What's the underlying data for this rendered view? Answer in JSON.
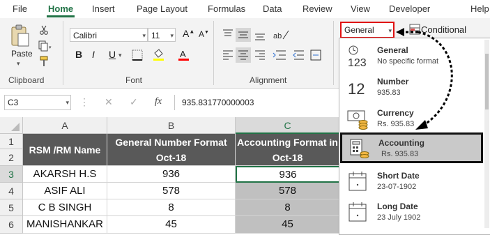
{
  "menu": {
    "tabs": [
      "File",
      "Home",
      "Insert",
      "Page Layout",
      "Formulas",
      "Data",
      "Review",
      "View",
      "Developer",
      "Help"
    ],
    "active": "Home"
  },
  "ribbon": {
    "clipboard": {
      "paste_label": "Paste",
      "group_label": "Clipboard"
    },
    "font": {
      "name": "Calibri",
      "size": "11",
      "group_label": "Font",
      "bold": "B",
      "italic": "I",
      "underline": "U"
    },
    "alignment": {
      "group_label": "Alignment"
    },
    "number": {
      "format_value": "General"
    },
    "styles": {
      "conditional_label": "Conditional"
    }
  },
  "formula_bar": {
    "name_box": "C3",
    "fx": "fx",
    "value": "935.831770000003"
  },
  "grid": {
    "columns": [
      "A",
      "B",
      "C"
    ],
    "rows": [
      "1",
      "2",
      "3",
      "4",
      "5",
      "6"
    ],
    "header_a": "RSM /RM Name",
    "header_b_line1": "General Number Format",
    "header_b_line2": "Oct-18",
    "header_c_line1": "Accounting Format in",
    "header_c_line2": "Oct-18",
    "data": [
      {
        "name": "AKARSH H.S",
        "general": "936",
        "accounting": "936"
      },
      {
        "name": "ASIF ALI",
        "general": "578",
        "accounting": "578"
      },
      {
        "name": "C B SINGH",
        "general": "8",
        "accounting": "8"
      },
      {
        "name": "MANISHANKAR",
        "general": "45",
        "accounting": "45"
      }
    ]
  },
  "format_dropdown": {
    "items": [
      {
        "title": "General",
        "sample": "No specific format",
        "icon": "general-123-icon",
        "glyph": "123"
      },
      {
        "title": "Number",
        "sample": "935.83",
        "icon": "number-12-icon",
        "glyph": "12"
      },
      {
        "title": "Currency",
        "sample": "Rs. 935.83",
        "icon": "currency-icon",
        "glyph": ""
      },
      {
        "title": "Accounting",
        "sample": "Rs. 935.83",
        "icon": "accounting-icon",
        "glyph": ""
      },
      {
        "title": "Short Date",
        "sample": "23-07-1902",
        "icon": "short-date-icon",
        "glyph": ""
      },
      {
        "title": "Long Date",
        "sample": "23 July 1902",
        "icon": "long-date-icon",
        "glyph": ""
      }
    ],
    "selected": "Accounting"
  },
  "colors": {
    "accent_green": "#217346",
    "header_fill": "#595959",
    "highlight_red": "#e01010",
    "selected_fill": "#c9c9c9",
    "data_fill_c": "#c0c0c0"
  }
}
